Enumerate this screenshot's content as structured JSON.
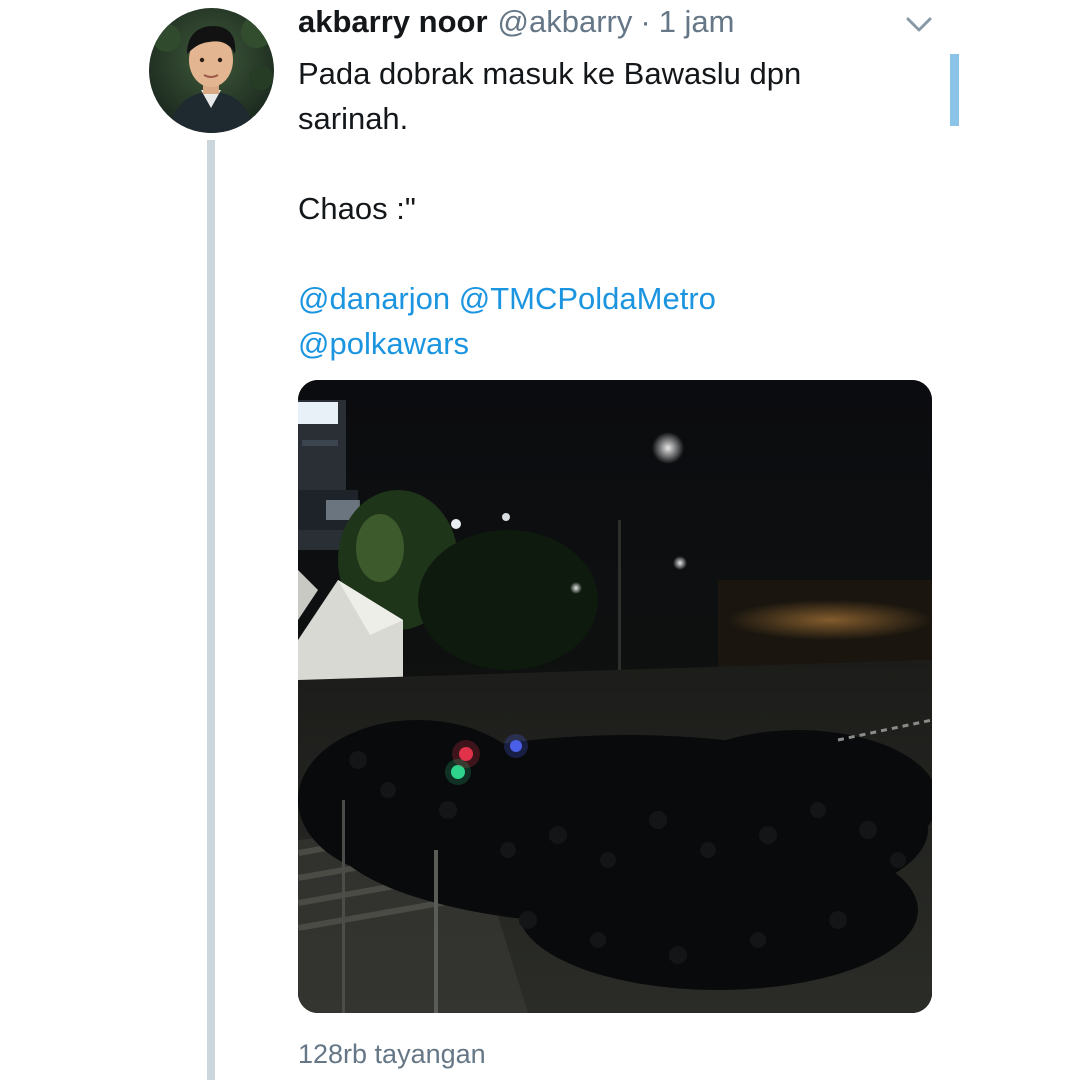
{
  "tweet": {
    "display_name": "akbarry noor",
    "handle": "@akbarry",
    "separator": "·",
    "time": "1 jam",
    "text_line1": "Pada dobrak masuk ke Bawaslu dpn",
    "text_line2": "sarinah.",
    "text_line3": "Chaos :\"",
    "mentions": [
      "@danarjon",
      "@TMCPoldaMetro",
      "@polkawars"
    ],
    "views": "128rb tayangan"
  },
  "icons": {
    "menu": "chevron-down-icon"
  },
  "colors": {
    "primary_text": "#14171a",
    "secondary_text": "#657786",
    "link": "#1b95e0",
    "thread_line": "#cbd6dc",
    "indicator": "#8cc4e8"
  }
}
